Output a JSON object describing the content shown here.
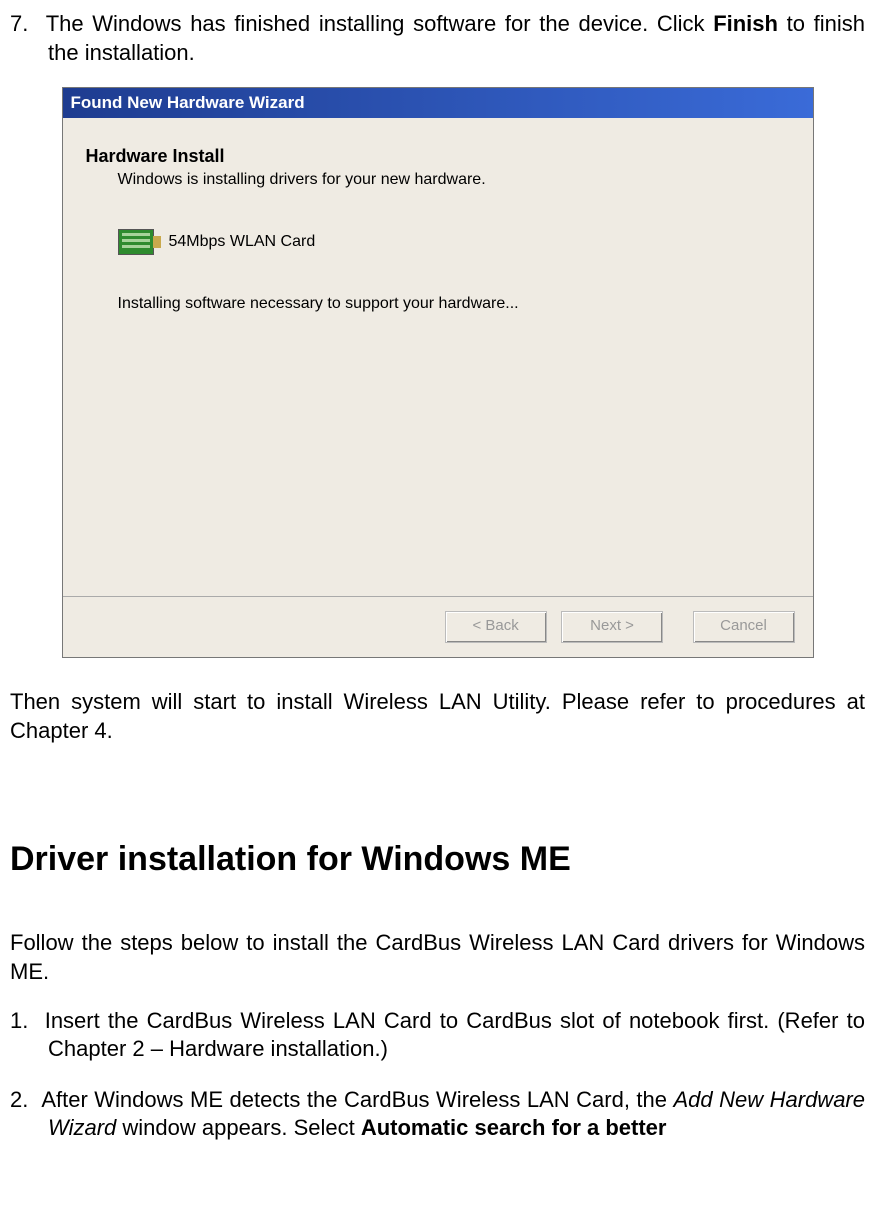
{
  "step7": {
    "num": "7.",
    "text_a": "The Windows has finished installing software for the device. Click ",
    "bold": "Finish",
    "text_b": " to finish the installation."
  },
  "wizard": {
    "title": "Found New Hardware Wizard",
    "heading": "Hardware Install",
    "sub": "Windows is installing drivers for your new hardware.",
    "device": "54Mbps WLAN Card",
    "status": "Installing software necessary to support your hardware...",
    "btn_back": "< Back",
    "btn_next": "Next >",
    "btn_cancel": "Cancel"
  },
  "after_wizard": "Then system will start to install Wireless LAN Utility. Please refer to procedures at Chapter 4.",
  "heading_me": "Driver installation for Windows ME",
  "intro_me": "Follow the steps below to install the CardBus Wireless LAN Card drivers for Windows ME.",
  "li1": {
    "num": "1.",
    "text": "Insert the CardBus Wireless LAN Card to CardBus slot of notebook first. (Refer to Chapter 2 – Hardware installation.)"
  },
  "li2": {
    "num": "2.",
    "a": "After Windows ME detects the CardBus Wireless LAN Card, the ",
    "i": "Add New Hardware Wizard",
    "b": " window appears. Select ",
    "bold": "Automatic search for a better"
  }
}
